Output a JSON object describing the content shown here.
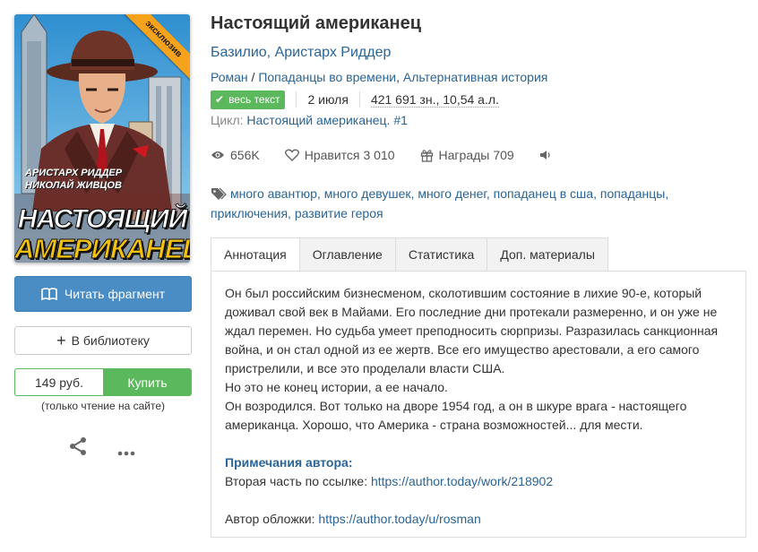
{
  "cover": {
    "ribbon": "эксклюзив",
    "authors_line1": "АРИСТАРХ РИДДЕР",
    "authors_line2": "НИКОЛАЙ ЖИВЦОВ",
    "title_line1": "НАСТОЯЩИЙ",
    "title_line2": "АМЕРИКАНЕЦ"
  },
  "actions": {
    "read_label": "Читать фрагмент",
    "library_label": "В библиотеку",
    "price": "149 руб.",
    "buy_label": "Купить",
    "price_note": "(только чтение на сайте)"
  },
  "book": {
    "title": "Настоящий американец",
    "author1": "Базилио",
    "author_sep": ", ",
    "author2": "Аристарх Риддер",
    "genre1": "Роман",
    "genre_sep1": " / ",
    "genre2": "Попаданцы во времени",
    "genre_sep2": ", ",
    "genre3": "Альтернативная история",
    "status_badge": "весь текст",
    "date": "2 июля",
    "size": "421 691 зн., 10,54 а.л.",
    "cycle_label": "Цикл:",
    "cycle_name": "Настоящий американец. #1"
  },
  "stats": {
    "views": "656K",
    "likes_label": "Нравится",
    "likes": "3 010",
    "awards_label": "Награды",
    "awards": "709"
  },
  "tags": [
    "много авантюр",
    "много девушек",
    "много денег",
    "попаданец в сша",
    "попаданцы",
    "приключения",
    "развитие героя"
  ],
  "tabs": [
    {
      "label": "Аннотация",
      "active": true
    },
    {
      "label": "Оглавление",
      "active": false
    },
    {
      "label": "Статистика",
      "active": false
    },
    {
      "label": "Доп. материалы",
      "active": false
    }
  ],
  "annotation": {
    "para1": "Он был российским бизнесменом, сколотившим состояние в лихие 90-е, который доживал свой век в Майами. Его последние дни протекали размеренно, и он уже не ждал перемен. Но судьба умеет преподносить сюрпризы. Разразилась санкционная война, и он стал одной из ее жертв. Все его имущество арестовали, а его самого пристрелили, и все это проделали власти США.",
    "para2": "Но это не конец истории, а ее начало.",
    "para3": "Он возродился. Вот только на дворе 1954 год, а он в шкуре врага - настоящего американца. Хорошо, что Америка - страна возможностей... для мести.",
    "notes_heading": "Примечания автора:",
    "sequel_text": "Вторая часть по ссылке: ",
    "sequel_link": "https://author.today/work/218902",
    "cover_text": "Автор обложки: ",
    "cover_link": "https://author.today/u/rosman"
  },
  "colors": {
    "link": "#2a6496",
    "read_button": "#4a8cc4",
    "buy_green": "#5cb85c",
    "ribbon": "#f7a21b"
  }
}
